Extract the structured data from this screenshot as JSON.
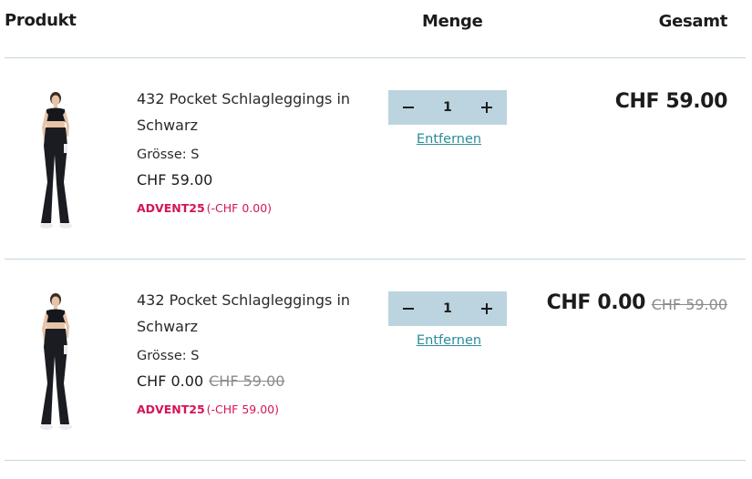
{
  "header": {
    "produkt": "Produkt",
    "menge": "Menge",
    "gesamt": "Gesamt"
  },
  "items": [
    {
      "name": "432 Pocket Schlagleggings in Schwarz",
      "size": "Grösse: S",
      "price": "CHF 59.00",
      "original_price": "",
      "discount_code": "ADVENT25",
      "discount_amount": "(-CHF 0.00)",
      "quantity": "1",
      "remove_label": "Entfernen",
      "total": "CHF 59.00",
      "total_original": ""
    },
    {
      "name": "432 Pocket Schlagleggings in Schwarz",
      "size": "Grösse: S",
      "price": "CHF 0.00",
      "original_price": "CHF 59.00",
      "discount_code": "ADVENT25",
      "discount_amount": "(-CHF 59.00)",
      "quantity": "1",
      "remove_label": "Entfernen",
      "total": "CHF 0.00",
      "total_original": "CHF 59.00"
    }
  ],
  "icons": {
    "minus": "minus-icon",
    "plus": "plus-icon"
  },
  "colors": {
    "divider": "#c5d5de",
    "quantity_bg": "#bcd4df",
    "link": "#2c8c99",
    "discount": "#d4145a"
  }
}
